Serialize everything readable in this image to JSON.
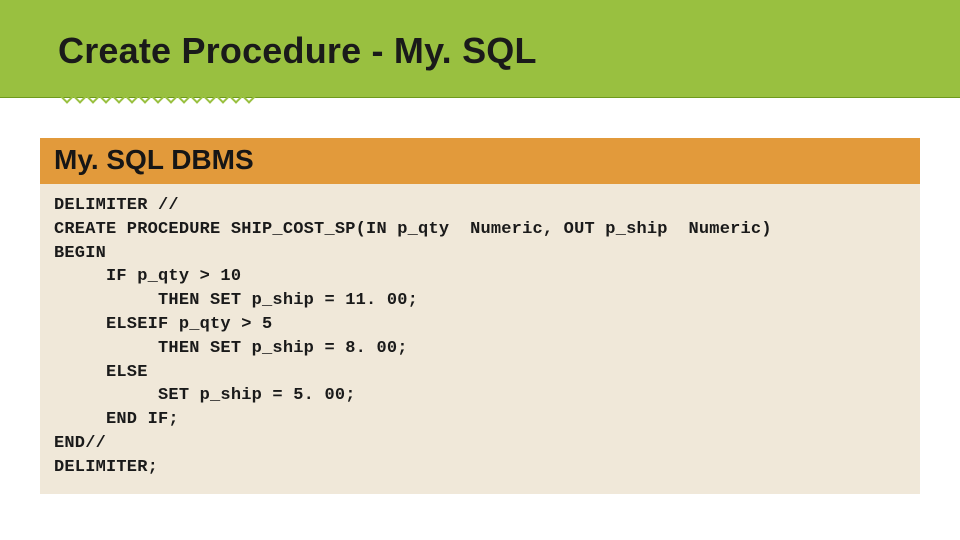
{
  "header": {
    "title": "Create Procedure - My. SQL"
  },
  "subheader": {
    "label": "My. SQL DBMS"
  },
  "code": {
    "lines": [
      "DELIMITER //",
      "CREATE PROCEDURE SHIP_COST_SP(IN p_qty  Numeric, OUT p_ship  Numeric)",
      "BEGIN",
      "     IF p_qty > 10",
      "          THEN SET p_ship = 11. 00;",
      "     ELSEIF p_qty > 5",
      "          THEN SET p_ship = 8. 00;",
      "     ELSE",
      "          SET p_ship = 5. 00;",
      "     END IF;",
      "END//",
      "DELIMITER;"
    ]
  }
}
